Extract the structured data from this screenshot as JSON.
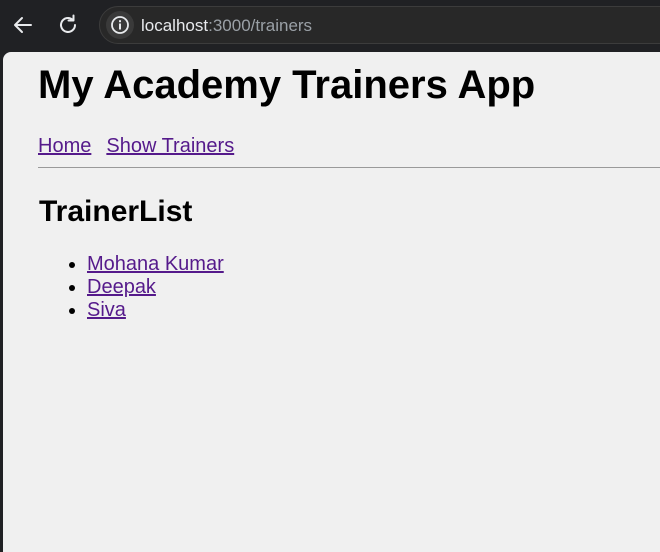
{
  "browser": {
    "url_host": "localhost",
    "url_path": ":3000/trainers",
    "back_icon": "back-arrow-icon",
    "reload_icon": "reload-icon",
    "info_icon": "info-icon"
  },
  "page": {
    "title": "My Academy Trainers App",
    "nav": [
      {
        "label": "Home"
      },
      {
        "label": "Show Trainers"
      }
    ],
    "section_title": "TrainerList",
    "trainers": [
      {
        "name": "Mohana Kumar"
      },
      {
        "name": "Deepak"
      },
      {
        "name": "Siva"
      }
    ],
    "colors": {
      "link_visited": "#551a8b",
      "page_background": "#f0f0f0",
      "browser_chrome": "#202124"
    }
  }
}
